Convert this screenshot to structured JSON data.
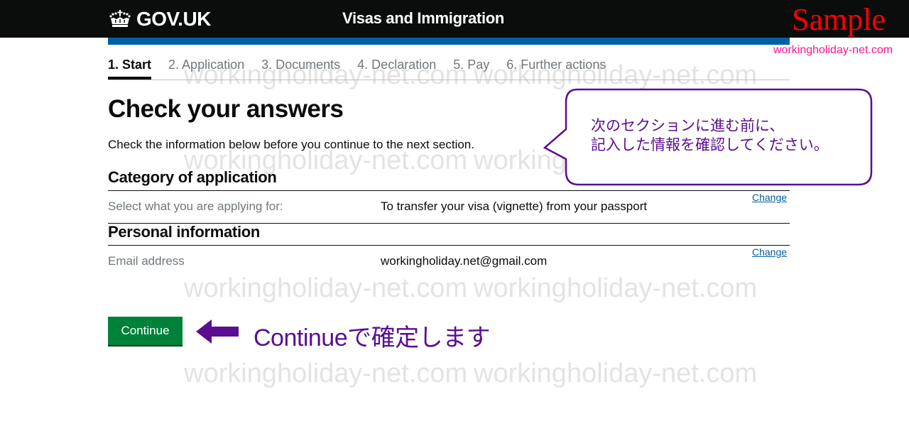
{
  "header": {
    "logo_icon": "crown-icon",
    "logo_text": "GOV.UK",
    "service_name": "Visas and Immigration",
    "sample_label": "Sample",
    "site_url": "workingholiday-net.com"
  },
  "steps": [
    {
      "label": "1. Start",
      "active": true
    },
    {
      "label": "2. Application",
      "active": false
    },
    {
      "label": "3. Documents",
      "active": false
    },
    {
      "label": "4. Declaration",
      "active": false
    },
    {
      "label": "5. Pay",
      "active": false
    },
    {
      "label": "6. Further actions",
      "active": false
    }
  ],
  "main": {
    "title": "Check your answers",
    "lede": "Check the information below before you continue to the next section.",
    "sections": [
      {
        "heading": "Category of application",
        "rows": [
          {
            "key": "Select what you are applying for:",
            "value": "To transfer your visa (vignette) from your passport",
            "action": "Change"
          }
        ]
      },
      {
        "heading": "Personal information",
        "rows": [
          {
            "key": "Email address",
            "value": "workingholiday.net@gmail.com",
            "action": "Change"
          }
        ]
      }
    ],
    "continue_label": "Continue"
  },
  "annotations": {
    "bubble_line1": "次のセクションに進む前に、",
    "bubble_line2": "記入した情報を確認してください。",
    "arrow_icon": "arrow-left-icon",
    "continue_note": "Continueで確定します",
    "accent_color": "#5b0e91"
  },
  "watermark_text": "workingholiday-net.com"
}
